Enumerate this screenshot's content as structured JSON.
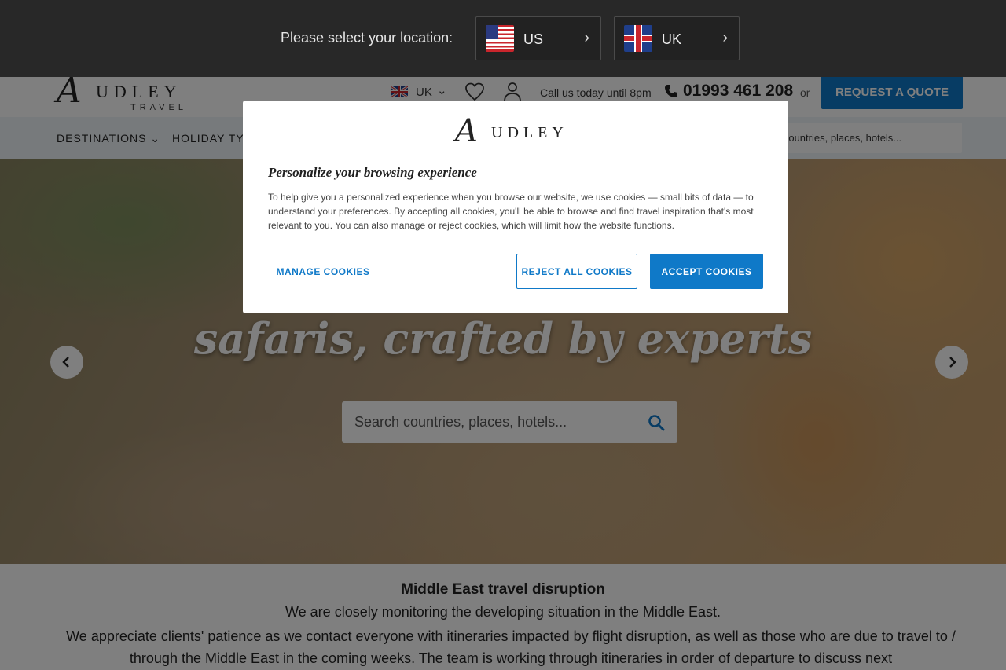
{
  "location_bar": {
    "label": "Please select your location:",
    "options": [
      {
        "code": "US",
        "flag": "us-flag-icon"
      },
      {
        "code": "UK",
        "flag": "uk-flag-icon"
      }
    ],
    "chevron": "›"
  },
  "header": {
    "logo": {
      "script_letter": "A",
      "wordmark": "UDLEY",
      "sub": "TRAVEL"
    },
    "country_code": "UK",
    "country_chevron": "⌄",
    "call_text": "Call us today until 8pm",
    "phone": "01993 461 208",
    "or_text": "or",
    "quote_button": "REQUEST A QUOTE"
  },
  "nav": {
    "items": [
      "DESTINATIONS ⌄",
      "HOLIDAY TY"
    ],
    "search_text": "h countries, places, hotels..."
  },
  "hero": {
    "title": "safaris, crafted by experts",
    "search_placeholder": "Search countries, places, hotels..."
  },
  "notice": {
    "title": "Middle East travel disruption",
    "line1": "We are closely monitoring the developing situation in the Middle East.",
    "body": "We appreciate clients' patience as we contact everyone with itineraries impacted by flight disruption, as well as those who are due to travel to / through the Middle East in the coming weeks. The team is working through itineraries in order of departure to discuss next"
  },
  "cookie_modal": {
    "logo": {
      "script_letter": "A",
      "wordmark": "UDLEY"
    },
    "title": "Personalize your browsing experience",
    "text": "To help give you a personalized experience when you browse our website, we use cookies — small bits of data — to understand your preferences. By accepting all cookies, you'll be able to browse and find travel inspiration that's most relevant to you. You can also manage or reject cookies, which will limit how the website functions.",
    "manage_label": "MANAGE COOKIES",
    "reject_label": "REJECT ALL COOKIES",
    "accept_label": "ACCEPT COOKIES"
  },
  "colors": {
    "accent_blue": "#0f79c8",
    "location_bar_bg": "#282828",
    "nav_bg": "#eef4f8"
  }
}
